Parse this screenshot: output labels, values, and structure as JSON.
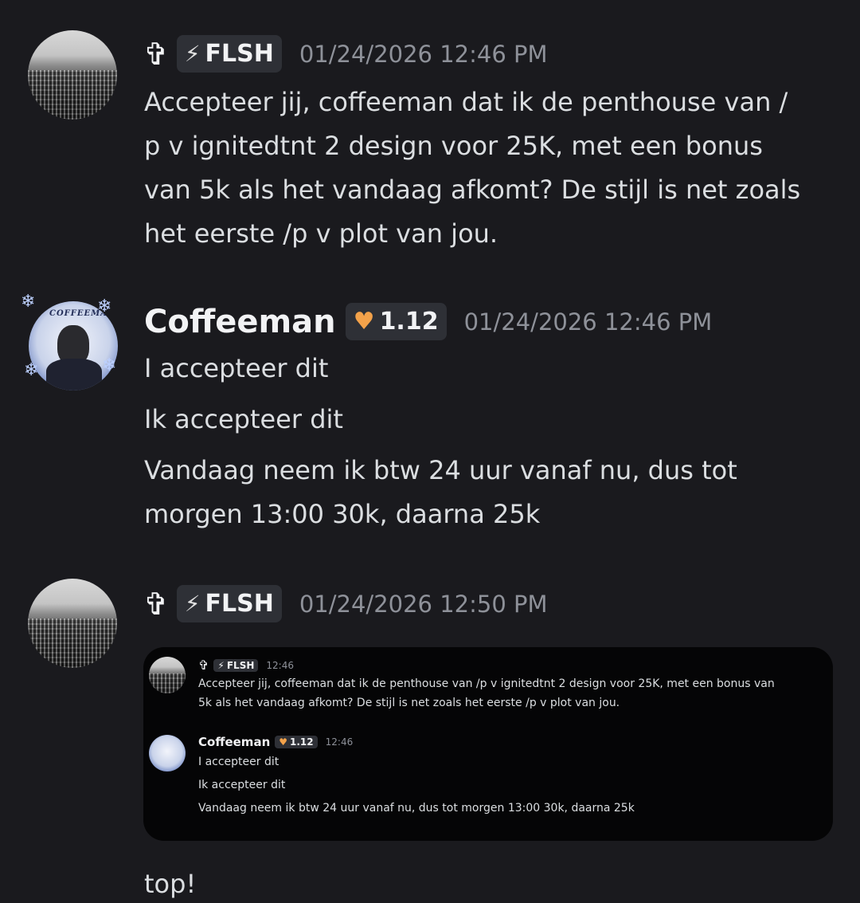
{
  "messages": [
    {
      "author_prefix": "✞",
      "tag": {
        "icon": "bolt-icon",
        "label": "FLSH"
      },
      "timestamp": "01/24/2026 12:46 PM",
      "lines": [
        "Accepteer jij, coffeeman dat ik de penthouse van /",
        "p v ignitedtnt 2 design voor 25K, met een bonus",
        "van 5k als het vandaag afkomt? De stijl is net zoals",
        "het eerste /p v plot van jou."
      ]
    },
    {
      "author": "Coffeeman",
      "avatar_text": "COFFEEMAN",
      "tag": {
        "icon": "heart-icon",
        "label": "1.12"
      },
      "timestamp": "01/24/2026 12:46 PM",
      "lines": [
        "I accepteer dit",
        "Ik accepteer dit",
        "Vandaag neem ik btw 24 uur vanaf nu, dus tot",
        "morgen 13:00 30k, daarna 25k"
      ]
    },
    {
      "author_prefix": "✞",
      "tag": {
        "icon": "bolt-icon",
        "label": "FLSH"
      },
      "timestamp": "01/24/2026 12:50 PM",
      "embed": {
        "first": {
          "author_prefix": "✞",
          "tag": "FLSH",
          "timestamp": "12:46",
          "lines": [
            "Accepteer jij, coffeeman dat ik de penthouse van /p v ignitedtnt 2 design voor 25K, met een bonus van",
            "5k als het vandaag afkomt? De stijl is net zoals het eerste /p v plot van jou."
          ]
        },
        "second": {
          "author": "Coffeeman",
          "tag": "1.12",
          "timestamp": "12:46",
          "lines": [
            "I accepteer dit",
            "Ik accepteer dit",
            "Vandaag neem ik btw 24 uur vanaf nu, dus tot morgen 13:00 30k, daarna 25k"
          ]
        }
      },
      "text": "top!"
    }
  ],
  "colors": {
    "background": "#1a1a1e",
    "tag_bg": "#2e3036",
    "timestamp": "#8e9199",
    "text": "#dbdee1",
    "heart": "#f3a24a"
  }
}
